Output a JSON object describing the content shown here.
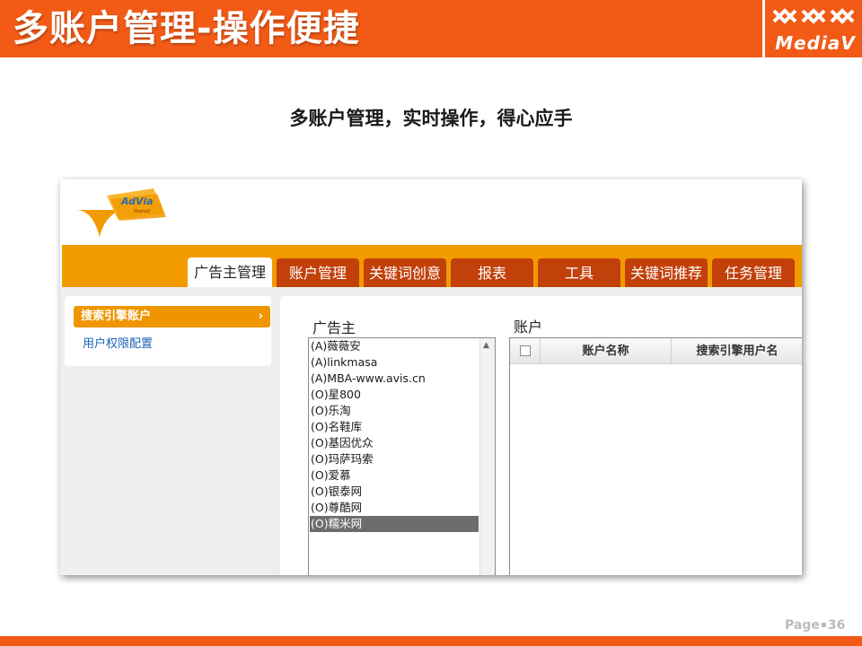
{
  "slide": {
    "title": "多账户管理-操作便捷",
    "subtitle": "多账户管理，实时操作，得心应手",
    "brand": "MediaV",
    "page_label": "Page",
    "page_number": "36"
  },
  "app": {
    "logo_text": "AdVia",
    "logo_sub": "MediaV",
    "tabs": [
      {
        "label": "广告主管理",
        "active": true
      },
      {
        "label": "账户管理",
        "active": false
      },
      {
        "label": "关键词创意",
        "active": false
      },
      {
        "label": "报表",
        "active": false
      },
      {
        "label": "工具",
        "active": false
      },
      {
        "label": "关键词推荐",
        "active": false
      },
      {
        "label": "任务管理",
        "active": false
      }
    ],
    "sidebar": {
      "items": [
        {
          "label": "搜索引擎账户",
          "active": true
        },
        {
          "label": "用户权限配置",
          "active": false
        }
      ]
    },
    "advertiser_label": "广告主",
    "account_label": "账户",
    "advertisers": [
      "(A)薇薇安",
      "(A)linkmasa",
      "(A)MBA-www.avis.cn",
      "(O)星800",
      "(O)乐淘",
      "(O)名鞋库",
      "(O)基因优众",
      "(O)玛萨玛索",
      "(O)爱慕",
      "(O)银泰网",
      "(O)尊酷网",
      "(O)糯米网"
    ],
    "selected_advertiser": "(O)糯米网",
    "account_columns": [
      "账户名称",
      "搜索引擎用户名"
    ]
  },
  "colors": {
    "slide_orange": "#f25a16",
    "nav_orange": "#f29b00",
    "tab_dark": "#c2400a",
    "sidebar_active": "#ee9500",
    "link_blue": "#1a63b7"
  }
}
